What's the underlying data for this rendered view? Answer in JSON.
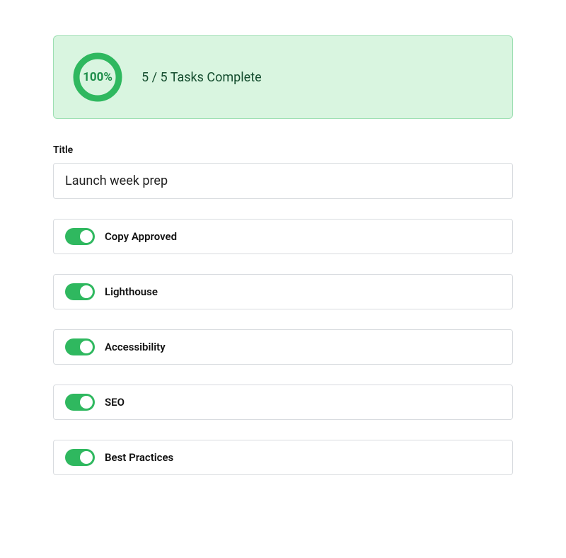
{
  "progress": {
    "percent_text": "100%",
    "percent_value": 100,
    "status_text": "5 / 5 Tasks Complete"
  },
  "title_field": {
    "label": "Title",
    "value": "Launch week prep"
  },
  "tasks": [
    {
      "label": "Copy Approved",
      "checked": true
    },
    {
      "label": "Lighthouse",
      "checked": true
    },
    {
      "label": "Accessibility",
      "checked": true
    },
    {
      "label": "SEO",
      "checked": true
    },
    {
      "label": "Best Practices",
      "checked": true
    }
  ],
  "colors": {
    "green": "#2fb85f",
    "green_light_bg": "#d9f5e0",
    "green_border": "#9ddfb2",
    "green_dark_text": "#144d2e"
  }
}
